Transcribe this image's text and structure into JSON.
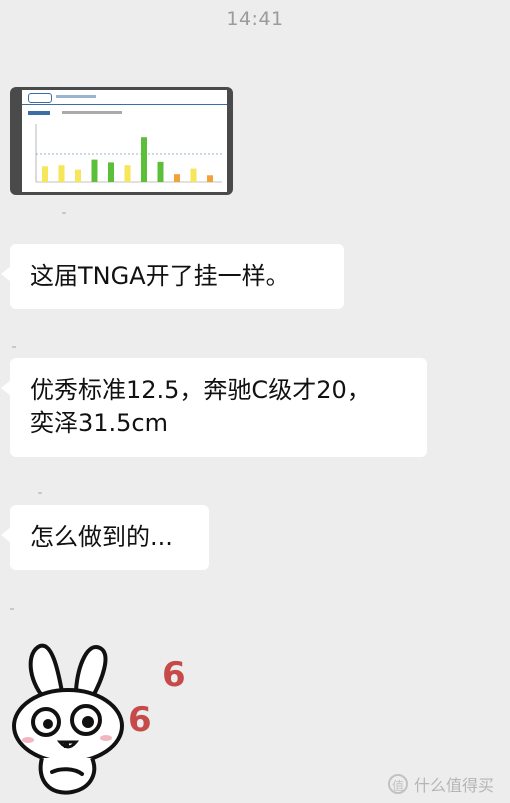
{
  "status": {
    "time": "14:41"
  },
  "messages": [
    {
      "type": "image",
      "alt": "chart screenshot"
    },
    {
      "type": "text",
      "text": "这届TNGA开了挂一样。"
    },
    {
      "type": "text",
      "text": "优秀标准12.5，奔驰C级才20，"
    },
    {
      "type": "text",
      "text": "奕泽31.5cm"
    },
    {
      "type": "text",
      "text": "怎么做到的..."
    },
    {
      "type": "sticker",
      "digits": [
        "6",
        "6"
      ]
    }
  ],
  "watermark": {
    "text": "什么值得买",
    "icon": "值"
  },
  "colors": {
    "background": "#ededed",
    "bubble": "#ffffff",
    "green": "#5cbf3a",
    "yellow": "#f5e65a",
    "orange": "#f2a23a",
    "six": "#c64a4a"
  },
  "thumb_bars": [
    {
      "v": 0.28,
      "c": "#f5e65a"
    },
    {
      "v": 0.3,
      "c": "#f5e65a"
    },
    {
      "v": 0.22,
      "c": "#f5e65a"
    },
    {
      "v": 0.4,
      "c": "#5cbf3a"
    },
    {
      "v": 0.35,
      "c": "#5cbf3a"
    },
    {
      "v": 0.3,
      "c": "#f5e65a"
    },
    {
      "v": 0.8,
      "c": "#5cbf3a"
    },
    {
      "v": 0.36,
      "c": "#5cbf3a"
    },
    {
      "v": 0.14,
      "c": "#f2a23a"
    },
    {
      "v": 0.24,
      "c": "#f5e65a"
    },
    {
      "v": 0.12,
      "c": "#f2a23a"
    }
  ]
}
